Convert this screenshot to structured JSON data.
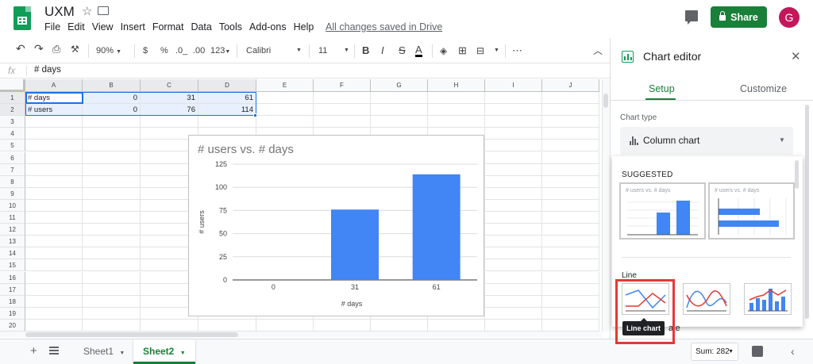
{
  "header": {
    "doc_title": "UXM",
    "menu": [
      "File",
      "Edit",
      "View",
      "Insert",
      "Format",
      "Data",
      "Tools",
      "Add-ons",
      "Help"
    ],
    "saved_status": "All changes saved in Drive",
    "share_label": "Share",
    "avatar_letter": "G"
  },
  "toolbar": {
    "zoom": "90%",
    "currency": "$",
    "percent": "%",
    "decrease_decimals": ".0_",
    "increase_decimals": ".00",
    "number_format": "123",
    "font": "Calibri",
    "font_size": "11",
    "bold": "B",
    "italic": "I",
    "strike": "S",
    "text_color": "A",
    "more": "⋯"
  },
  "formula_bar": {
    "fx": "fx",
    "value": "# days"
  },
  "grid": {
    "columns": [
      "A",
      "B",
      "C",
      "D",
      "E",
      "F",
      "G",
      "H",
      "I",
      "J"
    ],
    "rows": [
      "1",
      "2",
      "3",
      "4",
      "5",
      "6",
      "7",
      "8",
      "9",
      "10",
      "11",
      "12",
      "13",
      "14",
      "15",
      "16",
      "17",
      "18",
      "19",
      "20"
    ],
    "data": [
      [
        "# days",
        "0",
        "31",
        "61"
      ],
      [
        "# users",
        "0",
        "76",
        "114"
      ]
    ]
  },
  "chart_data": {
    "type": "bar",
    "title": "# users vs. # days",
    "xlabel": "# days",
    "ylabel": "# users",
    "categories": [
      "0",
      "31",
      "61"
    ],
    "values": [
      0,
      76,
      114
    ],
    "ylim": [
      0,
      125
    ],
    "yticks": [
      "0",
      "25",
      "50",
      "75",
      "100",
      "125"
    ],
    "grid": true,
    "bar_color": "#4285f4"
  },
  "bottom": {
    "add_sheet": "+",
    "sheets": [
      "Sheet1",
      "Sheet2"
    ],
    "active_sheet": "Sheet2",
    "sum": "Sum: 282"
  },
  "panel": {
    "title": "Chart editor",
    "tabs": [
      "Setup",
      "Customize"
    ],
    "chart_type_label": "Chart type",
    "chart_type_value": "Column chart",
    "suggested_heading": "SUGGESTED",
    "suggested_thumb_titles": [
      "# users vs. # days",
      "# users vs. # days"
    ],
    "line_heading": "Line",
    "tooltip": "Line chart",
    "behind_text": "ale"
  },
  "colors": {
    "accent_green": "#188038",
    "chart_blue": "#4285f4",
    "highlight_red": "#e53935"
  }
}
